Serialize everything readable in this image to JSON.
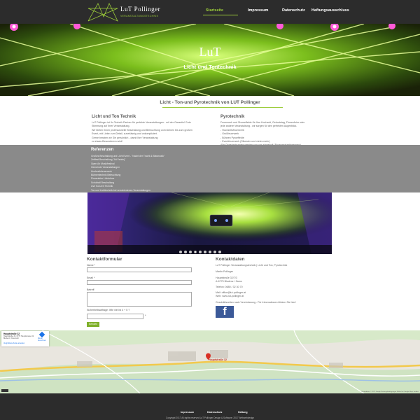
{
  "logo": {
    "text": "LuT Pollinger",
    "sub": "VERANSTALTUNGSTECHNIK"
  },
  "nav": [
    {
      "label": "Startseite",
      "active": true
    },
    {
      "label": "Impressum",
      "active": false
    },
    {
      "label": "Datenschutz",
      "active": false
    },
    {
      "label": "Haftungsausschluss",
      "active": false
    }
  ],
  "hero": {
    "title": "LuT",
    "subtitle": "Licht und Tontechnik"
  },
  "main": {
    "heading": "Licht - Ton-und Pyrotechnik von LUT Pollinger",
    "left": {
      "title": "Licht und Ton Technik",
      "lines": [
        "LuT Pollinger ist Ihr Technik Partner für perfekte Veranstaltungen - mit der Garantie! Gute",
        "Stimmung auf Ihrer Veranstaltung.",
        "Wir bieten Ihnen professionelle Beschallung und Beleuchtung vom kleinen bis zum großen",
        "Event, mit Liebe zum Detail, zuverlässig und unkompliziert.",
        "Gerne beraten wir Sie persönlich - damit Ihre Veranstaltung",
        "zu etwas Besonderem wird!"
      ]
    },
    "right": {
      "title": "Pyrotechnik",
      "lines": [
        "Feuerwerk und Showeffekte für Ihre Hochzeit, Geburtstag, Firmenfeier oder",
        "jede andere Veranstaltung - wir sorgen für den perfekten Augenblick.",
        "- Hochzeitsfeuerwerk",
        "- Großfeuerwerk",
        "- Bühnen Pyroeffekte",
        "- Eventfeuerwerk (Silvester und vieles mehr)",
        "Alle Genehmigungen werden von uns eingeholt (Feuerwerksabbrennen)."
      ]
    }
  },
  "refs": {
    "title": "Referenzen",
    "items": [
      "Großes Beschallung und Licht Event - \"Nacht der Tracht & Blasmusik\"",
      "Zeltfest Beschallung \"Alt Feriehj\"",
      "Open Air Musikfestival",
      "Gemeinde Veranstaltungen",
      "Hochzeitsfeuerwerk",
      "Bühnentechnik Beleuchtung",
      "Firmenfeier Lichtshow",
      "Schulball Beschallung",
      "Live Konzert Technik",
      "Ton und Lichttechnik bei verschiedenen Veranstaltungen",
      "uvm..."
    ]
  },
  "slider": {
    "dot_count": 9,
    "active_index": 3
  },
  "form": {
    "title": "Kontaktformular",
    "name_label": "Name *",
    "email_label": "Email *",
    "subject_label": "Betreff",
    "message_label": "Nachricht *",
    "captcha_label": "Sicherheitsabfrage: Wie viel ist 4 + 5 ?",
    "captcha_star": "*",
    "send_label": "Senden"
  },
  "contact": {
    "title": "Kontaktdaten",
    "company": "LuT Pollinger Veranstaltungstechnik | Licht und Ton, Pyrotechnik",
    "name": "Martin Pollinger",
    "street": "Hauptstraße 32/7/3",
    "city": "A-6775 Bludenz / Zams",
    "phone": "Telefon: 0680 / 32 30 70",
    "mail": "Mail: office@lut-pollinger.at",
    "web": "Web: www.lut-pollinger.at",
    "note": "Geschäftszeiten nach Vereinbarung - Für Informationen klicken Sie hier!",
    "fb_glyph": "f"
  },
  "map": {
    "card_title": "Hauptstraße 32",
    "card_addr": "Hauptstraße 32, 6775 Hauptstrasse 32 Bludenz, Österreich",
    "route_label": "Route berechnen",
    "link": "Vergrößerte Karte ansehen",
    "pin_label": "Hauptstraße 32",
    "footer": "Kartendaten © 2017 Google  Nutzungsbedingungen  Fehler bei Google Maps melden"
  },
  "footer": {
    "links": [
      "Impressum",
      "Datenschutz",
      "Haftung"
    ],
    "copyright": "Copyright 2017  All rights reserved LuT Pollinger  Design & Software: 2017 Webwebdesign"
  }
}
